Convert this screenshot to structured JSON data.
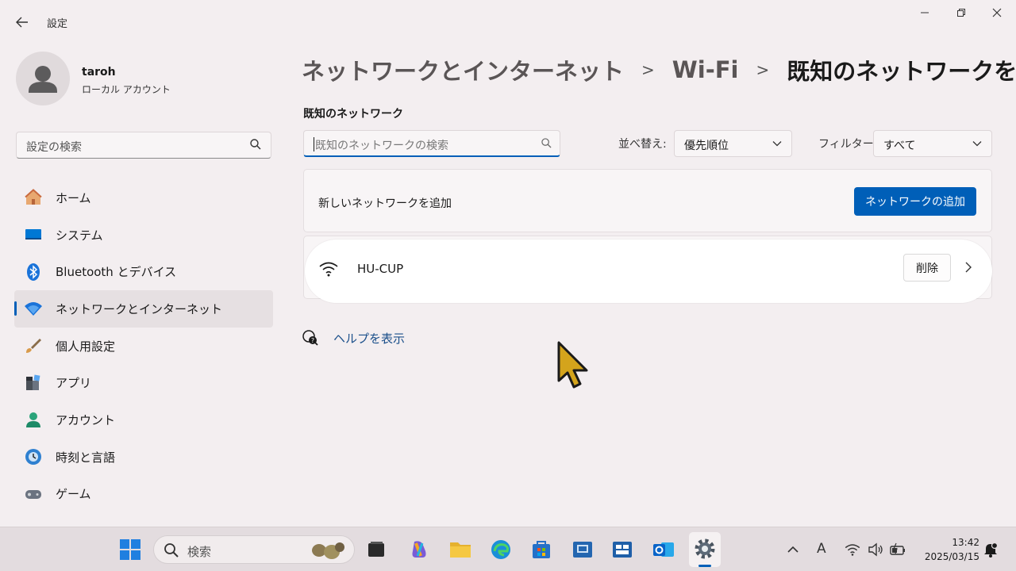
{
  "window": {
    "app_title": "設定",
    "back_icon": "arrow-left-icon"
  },
  "user": {
    "name": "taroh",
    "account_type": "ローカル アカウント"
  },
  "sidebar": {
    "search_placeholder": "設定の検索",
    "items": [
      {
        "label": "ホーム",
        "icon": "home-icon"
      },
      {
        "label": "システム",
        "icon": "system-icon"
      },
      {
        "label": "Bluetooth とデバイス",
        "icon": "bluetooth-icon"
      },
      {
        "label": "ネットワークとインターネット",
        "icon": "network-icon",
        "active": true
      },
      {
        "label": "個人用設定",
        "icon": "brush-icon"
      },
      {
        "label": "アプリ",
        "icon": "apps-icon"
      },
      {
        "label": "アカウント",
        "icon": "account-icon"
      },
      {
        "label": "時刻と言語",
        "icon": "time-language-icon"
      },
      {
        "label": "ゲーム",
        "icon": "gaming-icon"
      }
    ]
  },
  "breadcrumb": {
    "level1": "ネットワークとインターネット",
    "level2": "Wi-Fi",
    "current": "既知のネットワークを管理"
  },
  "known_networks": {
    "section_title": "既知のネットワーク",
    "search_placeholder": "既知のネットワークの検索",
    "sort_label": "並べ替え:",
    "sort_value": "優先順位",
    "filter_label": "フィルター:",
    "filter_value": "すべて",
    "add_text": "新しいネットワークを追加",
    "add_button": "ネットワークの追加",
    "networks": [
      {
        "name": "HU-CUP",
        "delete_label": "削除"
      }
    ]
  },
  "help": {
    "label": "ヘルプを表示"
  },
  "taskbar": {
    "search_placeholder": "検索",
    "clock_time": "13:42",
    "clock_date": "2025/03/15",
    "ime_indicator": "A"
  },
  "colors": {
    "accent": "#005fb8",
    "background": "#f3eef0",
    "taskbar": "#e3dcdf"
  }
}
